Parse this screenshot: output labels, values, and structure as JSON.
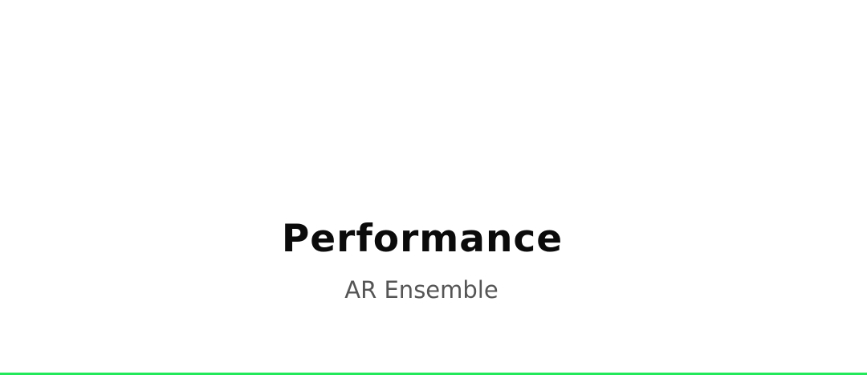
{
  "slide": {
    "title": "Performance",
    "subtitle": "AR Ensemble"
  },
  "colors": {
    "background": "#ffffff",
    "title": "#0b0b0b",
    "subtitle": "#555555",
    "accent": "#22e85a"
  }
}
